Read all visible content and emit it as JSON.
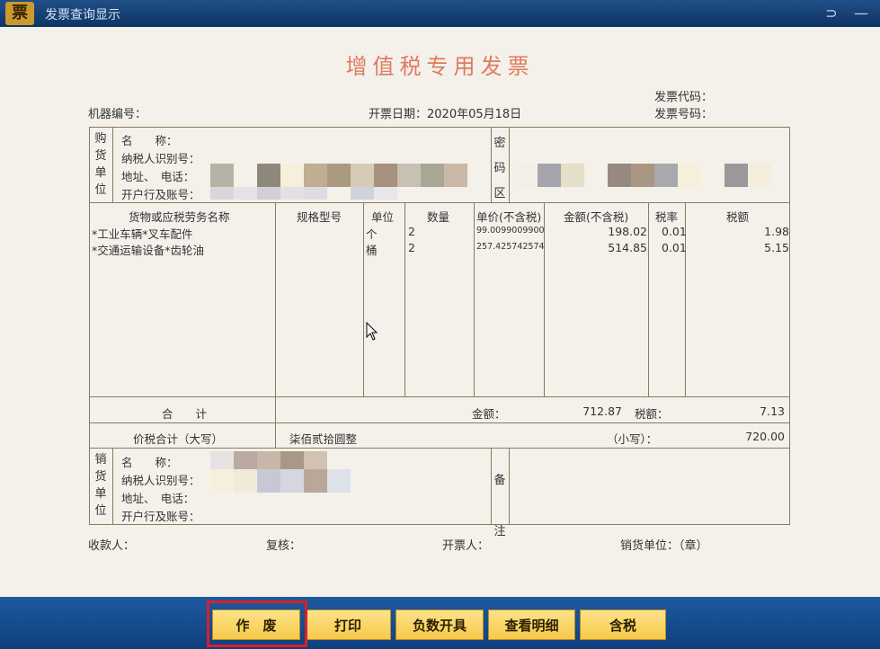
{
  "window": {
    "title": "发票查询显示",
    "logo_text": "票",
    "restore_glyph": "⊃"
  },
  "invoice": {
    "title": "增值税专用发票",
    "machine_no_label": "机器编号：",
    "issue_date_label": "开票日期：",
    "issue_date": "2020年05月18日",
    "code_label": "发票代码：",
    "number_label": "发票号码："
  },
  "buyer": {
    "side_label": [
      "购",
      "货",
      "单",
      "位"
    ],
    "name_label": "名　　称：",
    "taxid_label": "纳税人识别号：",
    "address_label": "地址、　电话：",
    "bank_label": "开户行及账号："
  },
  "cipher": {
    "side_label": [
      "密",
      "码",
      "区"
    ]
  },
  "items_header": {
    "name": "货物或应税劳务名称",
    "spec": "规格型号",
    "unit": "单位",
    "qty": "数量",
    "price": "单价(不含税)",
    "amount": "金额(不含税)",
    "rate": "税率",
    "tax": "税额"
  },
  "items": [
    {
      "name": "*工业车辆*叉车配件",
      "unit": "个",
      "qty": "2",
      "price": "99.0099009900",
      "amount": "198.02",
      "rate": "0.01",
      "tax": "1.98"
    },
    {
      "name": "*交通运输设备*齿轮油",
      "unit": "桶",
      "qty": "2",
      "price": "257.425742574",
      "amount": "514.85",
      "rate": "0.01",
      "tax": "5.15"
    }
  ],
  "totals": {
    "label": "合　　计",
    "amount_label": "金额：",
    "amount": "712.87",
    "tax_label": "税额：",
    "tax": "7.13",
    "grand_label": "价税合计（大写）",
    "grand_words": "柒佰贰拾圆整",
    "grand_small_label": "（小写）：",
    "grand_small": "720.00"
  },
  "seller": {
    "side_label": [
      "销",
      "货",
      "单",
      "位"
    ],
    "name_label": "名　　称：",
    "taxid_label": "纳税人识别号：",
    "address_label": "地址、　电话：",
    "bank_label": "开户行及账号："
  },
  "remarks": {
    "side_label": [
      "备",
      "注"
    ]
  },
  "footer": {
    "payee_label": "收款人：",
    "reviewer_label": "复核：",
    "issuer_label": "开票人：",
    "seller_seal_label": "销货单位：（章）"
  },
  "buttons": {
    "void": "作　废",
    "print": "打印",
    "negative": "负数开具",
    "details": "查看明细",
    "tax_incl": "含税"
  },
  "colors": {
    "title": "#e07a5f",
    "highlight": "#d8202a",
    "bar": "#1e5aa1",
    "button": "#f6c94a"
  }
}
